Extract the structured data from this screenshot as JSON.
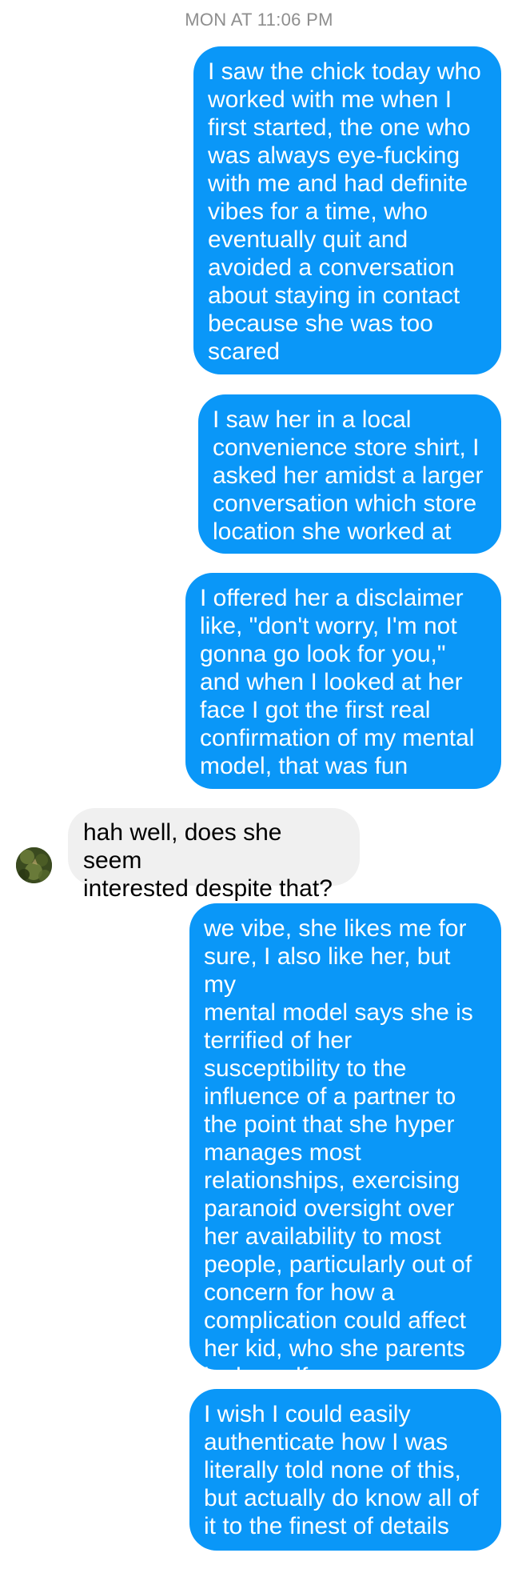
{
  "thread": {
    "timestamp": "MON AT 11:06 PM",
    "messages": [
      {
        "direction": "outgoing",
        "text": "I saw the chick today who\nworked with me when I\nfirst started, the one who\nwas always eye-fucking\nwith me and had definite\nvibes for a time, who\neventually quit and\navoided a conversation\nabout staying in contact\nbecause she was too\nscared"
      },
      {
        "direction": "outgoing",
        "text": "I saw her in a local\nconvenience store shirt, I\nasked her amidst a larger\nconversation which store\nlocation she worked at"
      },
      {
        "direction": "outgoing",
        "text": "I offered her a disclaimer\nlike, \"don't worry, I'm not\ngonna go look for you,\"\nand when I looked at her\nface I got the first real\nconfirmation of my mental\nmodel, that was fun"
      },
      {
        "direction": "incoming",
        "text": "hah well, does she seem\ninterested despite that?"
      },
      {
        "direction": "outgoing",
        "text": "we vibe, she likes me for\nsure, I also like her, but my\nmental model says she is\nterrified of her\nsusceptibility to the\ninfluence of a partner to\nthe point that she hyper\nmanages most\nrelationships, exercising\nparanoid oversight over\nher availability to most\npeople, particularly out of\nconcern for how a\ncomplication could affect\nher kid, who she parents\nby herself"
      },
      {
        "direction": "outgoing",
        "text": "I wish I could easily\nauthenticate how I was\nliterally told none of this,\nbut actually do know all of\nit to the finest of details"
      }
    ]
  },
  "colors": {
    "outgoing_bubble": "#0a97f8",
    "incoming_bubble": "#f0f0f0",
    "timestamp_text": "#8e8e8e"
  },
  "icons": {
    "avatar": "contact-avatar-photo"
  }
}
